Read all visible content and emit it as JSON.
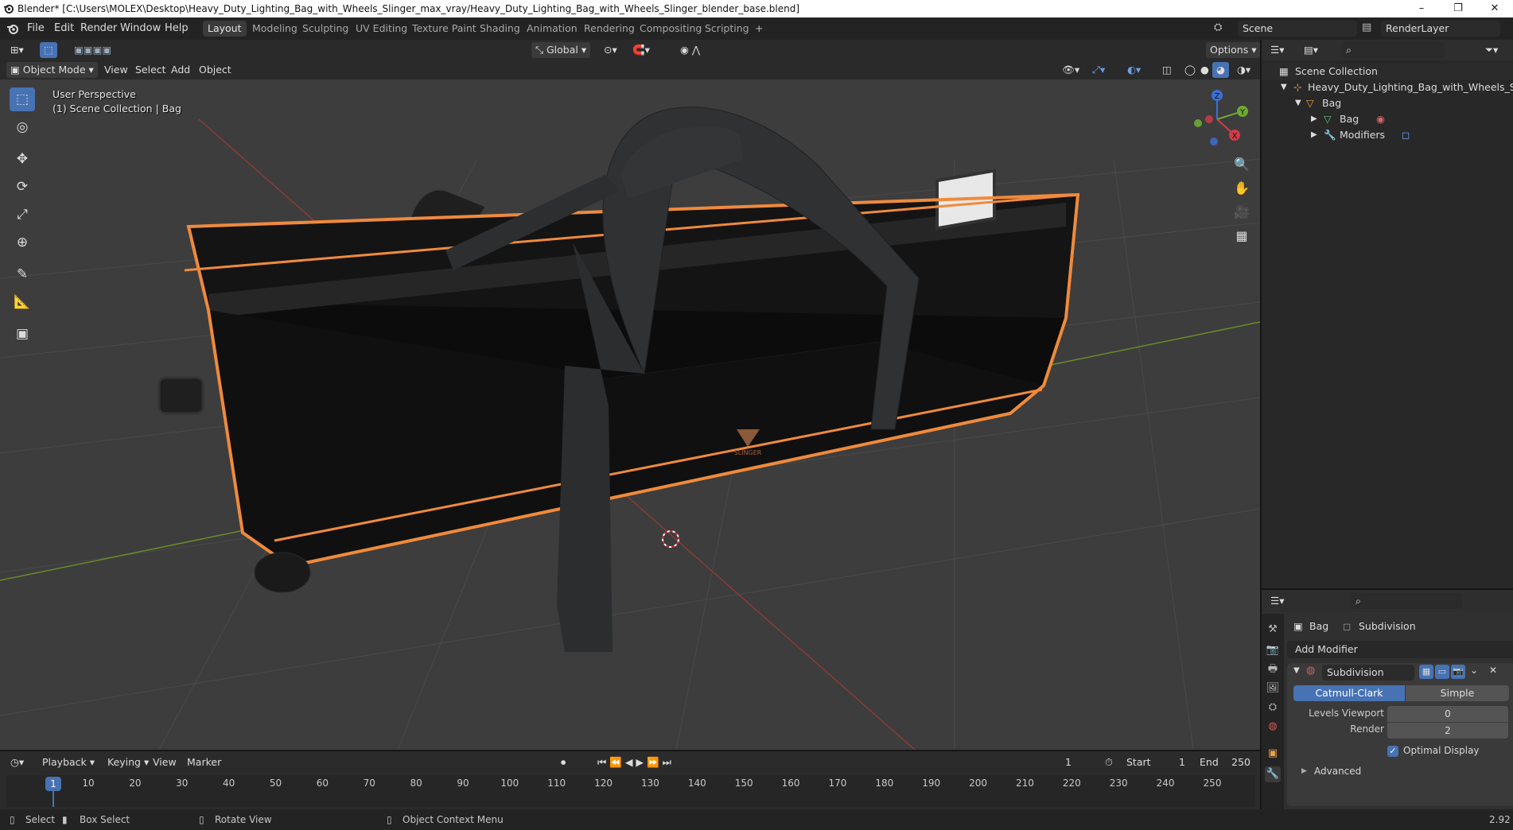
{
  "window": {
    "title": "Blender* [C:\\Users\\MOLEX\\Desktop\\Heavy_Duty_Lighting_Bag_with_Wheels_Slinger_max_vray/Heavy_Duty_Lighting_Bag_with_Wheels_Slinger_blender_base.blend]",
    "minimize": "–",
    "maximize": "❐",
    "close": "✕"
  },
  "menubar": {
    "items": [
      "File",
      "Edit",
      "Render",
      "Window",
      "Help"
    ],
    "workspaces": [
      "Layout",
      "Modeling",
      "Sculpting",
      "UV Editing",
      "Texture Paint",
      "Shading",
      "Animation",
      "Rendering",
      "Compositing",
      "Scripting"
    ],
    "active_workspace": "Layout",
    "add_tab": "+",
    "scene": "Scene",
    "render_layer": "RenderLayer"
  },
  "viewport_header": {
    "transform_orientation": "Global",
    "options": "Options",
    "mode": "Object Mode",
    "menus": [
      "View",
      "Select",
      "Add",
      "Object"
    ]
  },
  "viewport": {
    "perspective_label": "User Perspective",
    "collection_label": "(1) Scene Collection | Bag",
    "gizmo": {
      "z": "Z",
      "y": "Y",
      "x": "X"
    },
    "bag_logo_text": "SLINGER"
  },
  "outliner": {
    "root": "Scene Collection",
    "items": [
      {
        "label": "Heavy_Duty_Lighting_Bag_with_Wheels_Slir",
        "depth": 1
      },
      {
        "label": "Bag",
        "depth": 2
      },
      {
        "label": "Bag",
        "depth": 3
      },
      {
        "label": "Modifiers",
        "depth": 3
      }
    ]
  },
  "properties": {
    "object": "Bag",
    "modifier_context": "Subdivision",
    "add_modifier": "Add Modifier",
    "modifier": {
      "name": "Subdivision",
      "algorithms": [
        "Catmull-Clark",
        "Simple"
      ],
      "active_algorithm": "Catmull-Clark",
      "levels_viewport_label": "Levels Viewport",
      "levels_viewport": "0",
      "render_label": "Render",
      "render": "2",
      "optimal_display_label": "Optimal Display",
      "optimal_display": true,
      "advanced_label": "Advanced"
    }
  },
  "timeline": {
    "menus": [
      "Playback",
      "Keying",
      "View",
      "Marker"
    ],
    "current_frame": "1",
    "start_label": "Start",
    "start": "1",
    "end_label": "End",
    "end": "250",
    "ticks": [
      "1",
      "10",
      "20",
      "30",
      "40",
      "50",
      "60",
      "70",
      "80",
      "90",
      "100",
      "110",
      "120",
      "130",
      "140",
      "150",
      "160",
      "170",
      "180",
      "190",
      "200",
      "210",
      "220",
      "230",
      "240",
      "250"
    ]
  },
  "statusbar": {
    "select": "Select",
    "box_select": "Box Select",
    "rotate_view": "Rotate View",
    "context_menu": "Object Context Menu",
    "version": "2.92"
  },
  "colors": {
    "accent": "#4772b3",
    "selection_outline": "#f08a3c",
    "viewport_bg": "#3d3d3d",
    "panel_bg": "#282828"
  }
}
